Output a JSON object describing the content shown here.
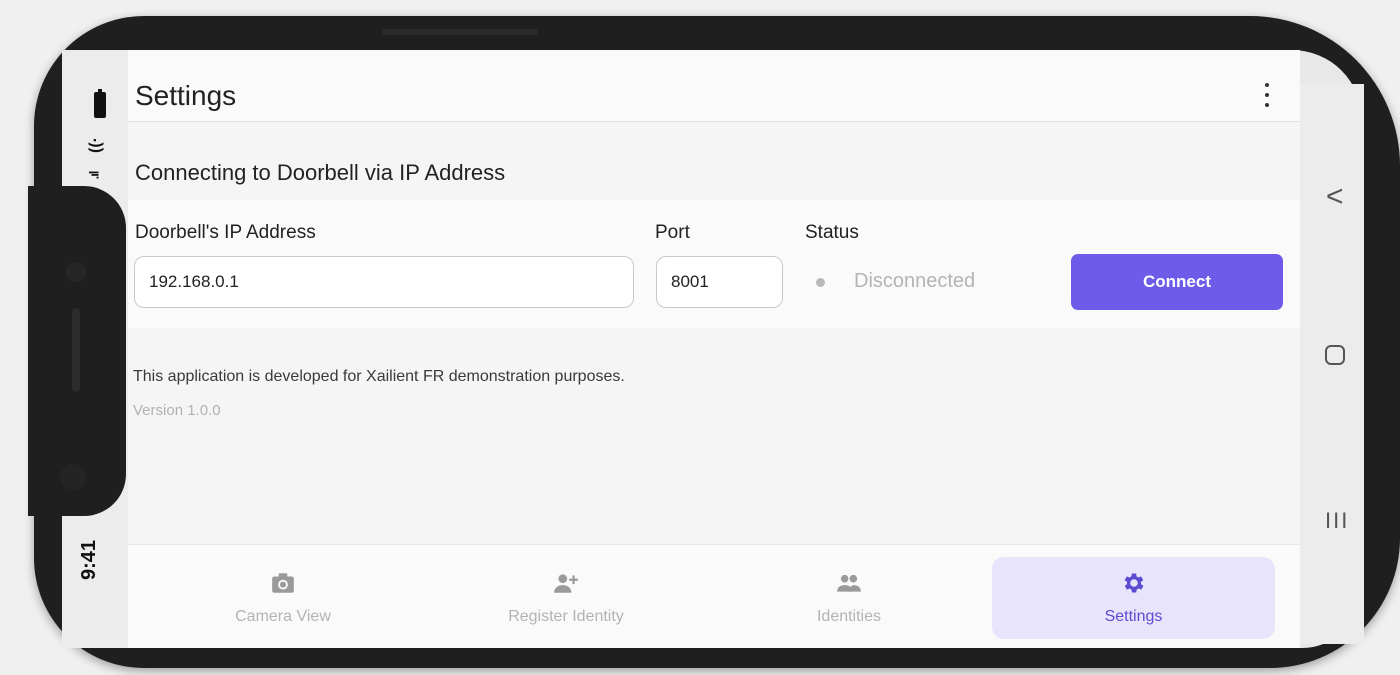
{
  "status_bar": {
    "time": "9:41",
    "wifi_icon": "wifi-icon",
    "signal_icon": "signal-icon",
    "battery_icon": "battery-icon"
  },
  "app_bar": {
    "title": "Settings",
    "menu_icon": "more-vert-icon"
  },
  "connection": {
    "section_title": "Connecting to Doorbell via IP Address",
    "ip_label": "Doorbell's IP Address",
    "ip_value": "192.168.0.1",
    "port_label": "Port",
    "port_value": "8001",
    "status_label": "Status",
    "status_value": "Disconnected",
    "connect_label": "Connect"
  },
  "about": {
    "info": "This application is developed for Xailient FR demonstration purposes.",
    "version": "Version 1.0.0"
  },
  "bottom_nav": {
    "items": [
      {
        "label": "Camera View",
        "icon": "camera-icon"
      },
      {
        "label": "Register Identity",
        "icon": "person-add-icon"
      },
      {
        "label": "Identities",
        "icon": "people-icon"
      },
      {
        "label": "Settings",
        "icon": "gear-icon",
        "active": true
      }
    ]
  },
  "system_nav": {
    "back": "<",
    "recents": "III"
  },
  "colors": {
    "accent": "#6f5bea",
    "active_nav_bg": "#e8e4fc",
    "status_inactive": "#b9b9b9"
  }
}
